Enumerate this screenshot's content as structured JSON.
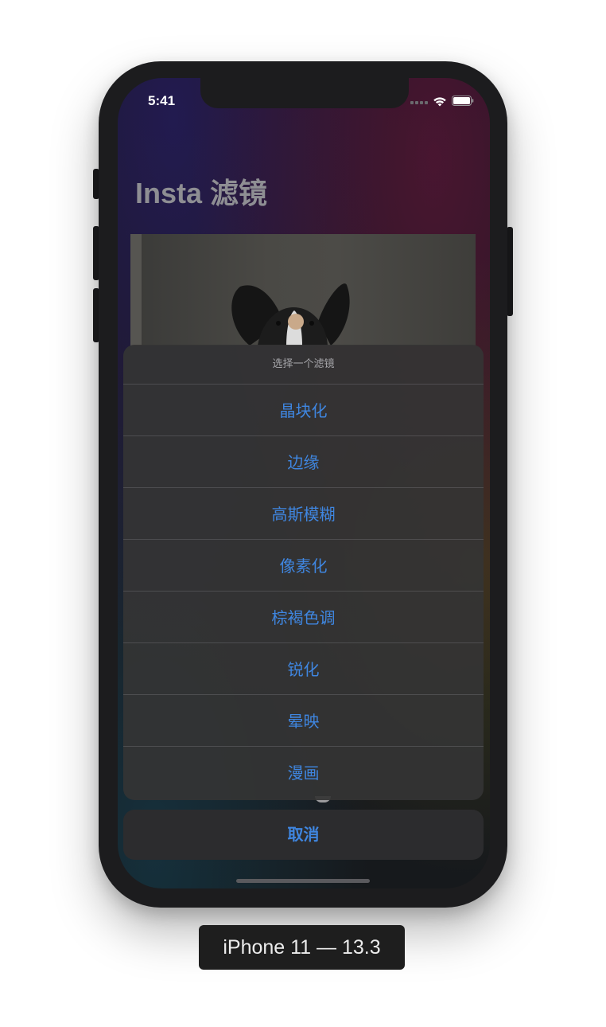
{
  "status_bar": {
    "time": "5:41"
  },
  "app": {
    "title": "Insta 滤镜"
  },
  "action_sheet": {
    "title": "选择一个滤镜",
    "items": [
      {
        "label": "晶块化"
      },
      {
        "label": "边缘"
      },
      {
        "label": "高斯模糊"
      },
      {
        "label": "像素化"
      },
      {
        "label": "棕褐色调"
      },
      {
        "label": "锐化"
      },
      {
        "label": "晕映"
      },
      {
        "label": "漫画"
      }
    ],
    "cancel_label": "取消"
  },
  "device": {
    "label": "iPhone 11 — 13.3"
  },
  "colors": {
    "action_tint": "#3f86e0",
    "sheet_background": "#343434",
    "cancel_background": "#2c2c2e"
  },
  "icons": [
    "wifi-icon",
    "battery-icon",
    "cellular-signal-icon"
  ]
}
